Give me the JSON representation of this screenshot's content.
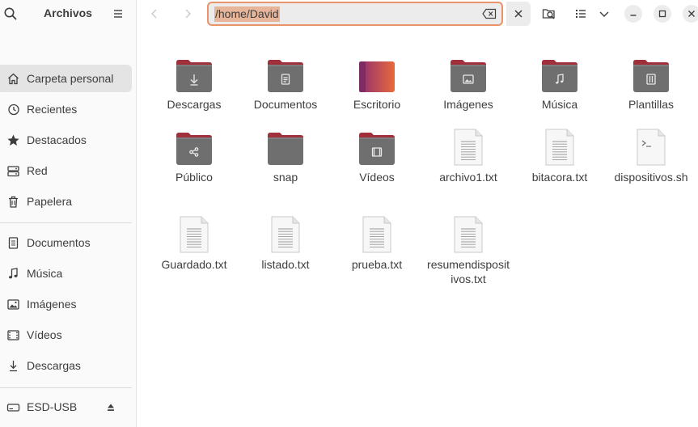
{
  "app": {
    "title": "Archivos"
  },
  "sidebar": {
    "items": [
      {
        "label": "Carpeta personal",
        "icon": "home-icon",
        "active": true
      },
      {
        "label": "Recientes",
        "icon": "recent-icon"
      },
      {
        "label": "Destacados",
        "icon": "star-icon"
      },
      {
        "label": "Red",
        "icon": "network-icon"
      },
      {
        "label": "Papelera",
        "icon": "trash-icon"
      },
      {
        "label": "Documentos",
        "icon": "document-icon"
      },
      {
        "label": "Música",
        "icon": "music-icon"
      },
      {
        "label": "Imágenes",
        "icon": "image-icon"
      },
      {
        "label": "Vídeos",
        "icon": "video-icon"
      },
      {
        "label": "Descargas",
        "icon": "download-icon"
      },
      {
        "label": "ESD-USB",
        "icon": "drive-icon"
      }
    ]
  },
  "location": {
    "path": "/home/David"
  },
  "files": [
    {
      "name": "Descargas",
      "kind": "folder",
      "emblem": "download"
    },
    {
      "name": "Documentos",
      "kind": "folder",
      "emblem": "document"
    },
    {
      "name": "Escritorio",
      "kind": "desktop"
    },
    {
      "name": "Imágenes",
      "kind": "folder",
      "emblem": "image"
    },
    {
      "name": "Música",
      "kind": "folder",
      "emblem": "music"
    },
    {
      "name": "Plantillas",
      "kind": "folder",
      "emblem": "template"
    },
    {
      "name": "Público",
      "kind": "folder",
      "emblem": "share"
    },
    {
      "name": "snap",
      "kind": "folder",
      "emblem": ""
    },
    {
      "name": "Vídeos",
      "kind": "folder",
      "emblem": "video"
    },
    {
      "name": "archivo1.txt",
      "kind": "text"
    },
    {
      "name": "bitacora.txt",
      "kind": "text"
    },
    {
      "name": "dispositivos.sh",
      "kind": "script"
    },
    {
      "name": "Guardado.txt",
      "kind": "text"
    },
    {
      "name": "listado.txt",
      "kind": "text"
    },
    {
      "name": "prueba.txt",
      "kind": "text"
    },
    {
      "name": "resumendispositivos.txt",
      "kind": "text"
    }
  ],
  "colors": {
    "accent": "#e9946b",
    "folder_tab": "#a0303c",
    "folder_body": "#6f6f6f",
    "desktop_from": "#8e2f72",
    "desktop_to": "#e86a3c"
  }
}
